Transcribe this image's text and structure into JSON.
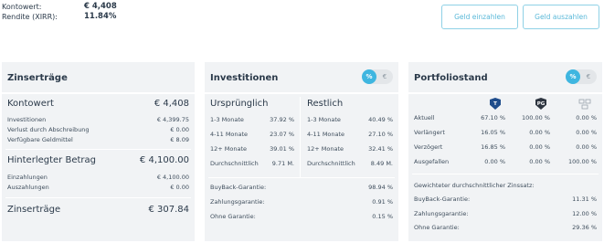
{
  "top": {
    "kontowert_label": "Kontowert:",
    "kontowert_value": "€ 4,408",
    "rendite_label": "Rendite (XIRR):",
    "rendite_value": "11.84%"
  },
  "buttons": {
    "einzahlen": "Geld einzahlen",
    "auszahlen": "Geld auszahlen"
  },
  "zins": {
    "title": "Zinserträge",
    "kontowert_label": "Kontowert",
    "kontowert_value": "€ 4,408",
    "rows1": [
      {
        "label": "Investitionen",
        "value": "€ 4,399.75"
      },
      {
        "label": "Verlust durch Abschreibung",
        "value": "€ 0.00"
      },
      {
        "label": "Verfügbare Geldmittel",
        "value": "€ 8.09"
      }
    ],
    "hinterlegt_label": "Hinterlegter Betrag",
    "hinterlegt_value": "€ 4,100.00",
    "rows2": [
      {
        "label": "Einzahlungen",
        "value": "€ 4,100.00"
      },
      {
        "label": "Auszahlungen",
        "value": "€ 0.00"
      }
    ],
    "ertraege_label": "Zinserträge",
    "ertraege_value": "€ 307.84"
  },
  "invest": {
    "title": "Investitionen",
    "toggle_on": "%",
    "toggle_off": "€",
    "col1_title": "Ursprünglich",
    "col2_title": "Restlich",
    "col1": [
      {
        "label": "1-3 Monate",
        "value": "37.92 %"
      },
      {
        "label": "4-11 Monate",
        "value": "23.07 %"
      },
      {
        "label": "12+ Monate",
        "value": "39.01 %"
      },
      {
        "label": "Durchschnittlich",
        "value": "9.71 M."
      }
    ],
    "col2": [
      {
        "label": "1-3 Monate",
        "value": "40.49 %"
      },
      {
        "label": "4-11 Monate",
        "value": "27.10 %"
      },
      {
        "label": "12+ Monate",
        "value": "32.41 %"
      },
      {
        "label": "Durchschnittlich",
        "value": "8.49 M."
      }
    ],
    "guarantees": [
      {
        "label": "BuyBack-Garantie:",
        "value": "98.94 %"
      },
      {
        "label": "Zahlungsgarantie:",
        "value": "0.91 %"
      },
      {
        "label": "Ohne Garantie:",
        "value": "0.15 %"
      }
    ]
  },
  "portfolio": {
    "title": "Portfoliostand",
    "toggle_on": "%",
    "toggle_off": "€",
    "icon_labels": {
      "t": "T",
      "pg": "PG"
    },
    "rows": [
      {
        "label": "Aktuell",
        "v1": "67.10 %",
        "v2": "100.00 %",
        "v3": "0.00 %"
      },
      {
        "label": "Verlängert",
        "v1": "16.05 %",
        "v2": "0.00 %",
        "v3": "0.00 %"
      },
      {
        "label": "Verzögert",
        "v1": "16.85 %",
        "v2": "0.00 %",
        "v3": "0.00 %"
      },
      {
        "label": "Ausgefallen",
        "v1": "0.00 %",
        "v2": "0.00 %",
        "v3": "100.00 %"
      }
    ],
    "weighted_title": "Gewichteter durchschnittlicher Zinssatz:",
    "weighted": [
      {
        "label": "BuyBack-Garantie:",
        "value": "11.31 %"
      },
      {
        "label": "Zahlungsgarantie:",
        "value": "12.00 %"
      },
      {
        "label": "Ohne Garantie:",
        "value": "29.36 %"
      }
    ]
  },
  "colors": {
    "accent": "#3fb6e0",
    "panel": "#f1f3f5",
    "text": "#2b3a4a"
  }
}
